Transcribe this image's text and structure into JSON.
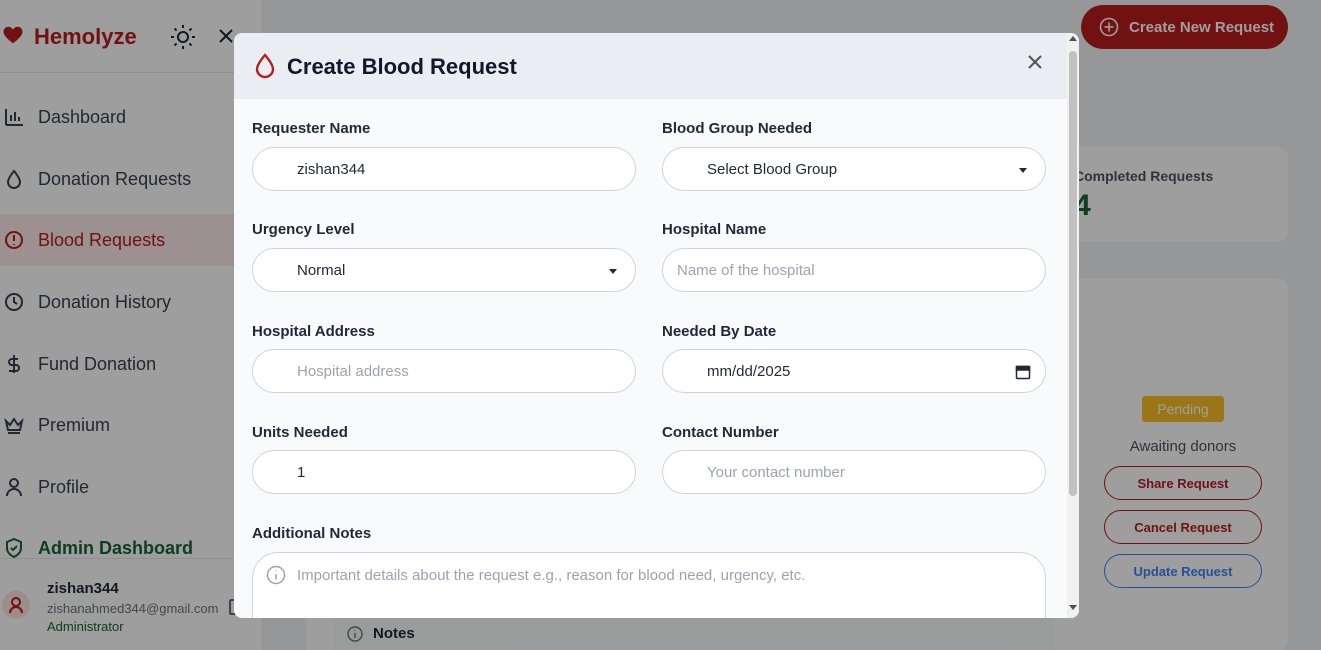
{
  "app": {
    "name": "Hemolyze",
    "brand_color": "#b91c1c"
  },
  "sidebar": {
    "items": [
      {
        "label": "Dashboard",
        "icon": "bar-chart-icon"
      },
      {
        "label": "Donation Requests",
        "icon": "droplet-icon"
      },
      {
        "label": "Blood Requests",
        "icon": "alert-circle-icon",
        "active": true
      },
      {
        "label": "Donation History",
        "icon": "clock-icon"
      },
      {
        "label": "Fund Donation",
        "icon": "dollar-icon"
      },
      {
        "label": "Premium",
        "icon": "crown-icon"
      },
      {
        "label": "Profile",
        "icon": "user-icon"
      },
      {
        "label": "Admin Dashboard",
        "icon": "shield-icon"
      }
    ],
    "user": {
      "name": "zishan344",
      "email": "zishanahmed344@gmail.com",
      "role": "Administrator"
    }
  },
  "header": {
    "create_button_label": "Create New Request"
  },
  "stats": {
    "completed_label": "Completed Requests",
    "completed_value": "4"
  },
  "request_card": {
    "status": "Pending",
    "status_note": "Awaiting donors",
    "share_label": "Share Request",
    "cancel_label": "Cancel Request",
    "update_label": "Update Request",
    "notes_label": "Notes"
  },
  "modal": {
    "title": "Create Blood Request",
    "fields": {
      "requester_name": {
        "label": "Requester Name",
        "value": "zishan344"
      },
      "blood_group": {
        "label": "Blood Group Needed",
        "value": "Select Blood Group"
      },
      "urgency": {
        "label": "Urgency Level",
        "value": "Normal"
      },
      "hospital_name": {
        "label": "Hospital Name",
        "placeholder": "Name of the hospital"
      },
      "hospital_address": {
        "label": "Hospital Address",
        "placeholder": "Hospital address"
      },
      "needed_by": {
        "label": "Needed By Date",
        "value": "mm/dd/2025"
      },
      "units": {
        "label": "Units Needed",
        "value": "1"
      },
      "contact": {
        "label": "Contact Number",
        "placeholder": "Your contact number"
      },
      "notes": {
        "label": "Additional Notes",
        "placeholder": "Important details about the request e.g., reason for blood need, urgency, etc."
      }
    }
  }
}
